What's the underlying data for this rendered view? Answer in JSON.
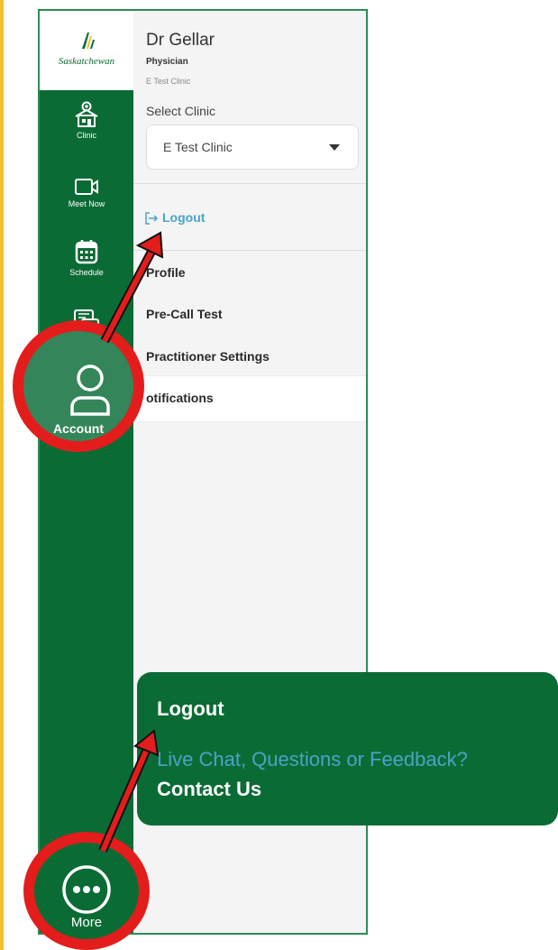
{
  "brand": {
    "logo_text": "Saskatchewan"
  },
  "sidebar": {
    "items": [
      {
        "label": "Clinic",
        "icon": "clinic-icon"
      },
      {
        "label": "Meet Now",
        "icon": "video-camera-icon"
      },
      {
        "label": "Schedule",
        "icon": "calendar-icon"
      },
      {
        "label": "Account",
        "icon": "person-icon"
      },
      {
        "label": "More",
        "icon": "more-dots-icon"
      }
    ]
  },
  "account_panel": {
    "name": "Dr Gellar",
    "role": "Physician",
    "clinic_name": "E Test Clinic",
    "select_clinic_label": "Select Clinic",
    "selected_clinic": "E Test Clinic",
    "logout_label": "Logout",
    "menu": [
      "Profile",
      "Pre-Call Test",
      "Practitioner Settings",
      "otifications"
    ]
  },
  "more_popup": {
    "logout": "Logout",
    "chat_text": "Live Chat, Questions or Feedback?",
    "contact": "Contact Us"
  },
  "colors": {
    "primary_green": "#0b6b35",
    "link_blue": "#4aa3c6",
    "annotation_red": "#e31c1c",
    "page_border_yellow": "#f2c12e"
  }
}
